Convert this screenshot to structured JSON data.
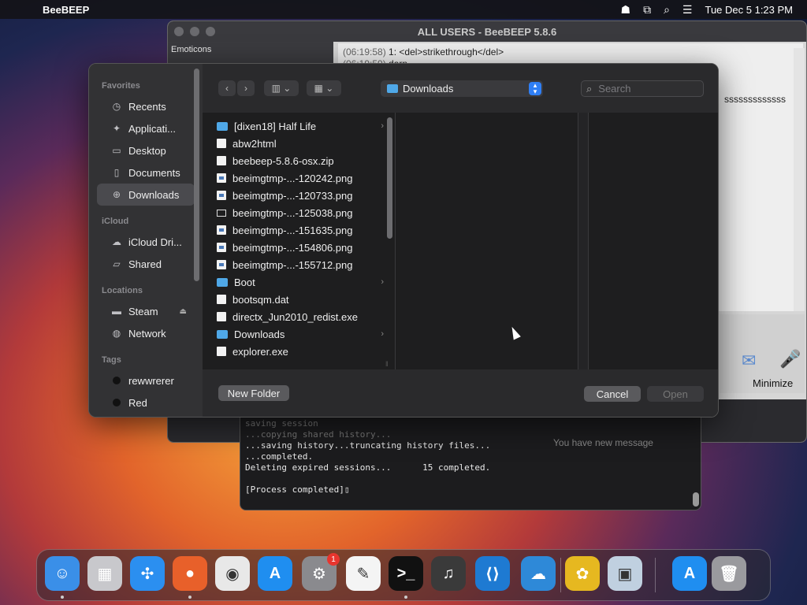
{
  "menubar": {
    "app_name": "BeeBEEP",
    "datetime": "Tue Dec 5  1:23 PM"
  },
  "beebeep": {
    "title": "ALL USERS - BeeBEEP 5.8.6",
    "emoticons_label": "Emoticons",
    "chat_lines": [
      {
        "ts": "(06:19:58)",
        "text": "1: <del>strikethrough</del>"
      },
      {
        "ts": "(06:19:59)",
        "text": "darn"
      }
    ],
    "chat_tail": "sssssssssssss",
    "minimize_label": "Minimize",
    "notification": "You have new message"
  },
  "terminal": {
    "lines": [
      "...saving history...truncating history files...",
      "...completed.",
      "Deleting expired sessions...      15 completed.",
      "",
      "[Process completed]"
    ],
    "faded_lines": [
      "saving session",
      "...copying shared history..."
    ]
  },
  "dialog": {
    "sidebar": {
      "favorites_header": "Favorites",
      "favorites": [
        "Recents",
        "Applicati...",
        "Desktop",
        "Documents",
        "Downloads"
      ],
      "icloud_header": "iCloud",
      "icloud": [
        "iCloud Dri...",
        "Shared"
      ],
      "locations_header": "Locations",
      "locations": [
        "Steam",
        "Network"
      ],
      "tags_header": "Tags",
      "tags": [
        {
          "label": "rewwrerer",
          "color": "#111111"
        },
        {
          "label": "Red",
          "color": "#111111"
        }
      ]
    },
    "location": "Downloads",
    "search_placeholder": "Search",
    "files": [
      {
        "name": "[dixen18] Half Life",
        "kind": "folder",
        "has_children": true
      },
      {
        "name": "abw2html",
        "kind": "doc",
        "has_children": false
      },
      {
        "name": "beebeep-5.8.6-osx.zip",
        "kind": "doc",
        "has_children": false
      },
      {
        "name": "beeimgtmp-...-120242.png",
        "kind": "img",
        "has_children": false
      },
      {
        "name": "beeimgtmp-...-120733.png",
        "kind": "img",
        "has_children": false
      },
      {
        "name": "beeimgtmp-...-125038.png",
        "kind": "blank",
        "has_children": false
      },
      {
        "name": "beeimgtmp-...-151635.png",
        "kind": "img",
        "has_children": false
      },
      {
        "name": "beeimgtmp-...-154806.png",
        "kind": "img",
        "has_children": false
      },
      {
        "name": "beeimgtmp-...-155712.png",
        "kind": "img",
        "has_children": false
      },
      {
        "name": "Boot",
        "kind": "folder",
        "has_children": true
      },
      {
        "name": "bootsqm.dat",
        "kind": "doc",
        "has_children": false
      },
      {
        "name": "directx_Jun2010_redist.exe",
        "kind": "doc",
        "has_children": false
      },
      {
        "name": "Downloads",
        "kind": "folder",
        "has_children": true
      },
      {
        "name": "explorer.exe",
        "kind": "doc",
        "has_children": false
      }
    ],
    "new_folder_label": "New Folder",
    "cancel_label": "Cancel",
    "open_label": "Open"
  },
  "dock": {
    "apps": [
      {
        "name": "finder-icon",
        "color": "#3a8fe8",
        "glyph": "☺"
      },
      {
        "name": "launchpad-icon",
        "color": "#c8c8cc",
        "glyph": "▦"
      },
      {
        "name": "safari-icon",
        "color": "#2b8ff0",
        "glyph": "✣"
      },
      {
        "name": "firefox-icon",
        "color": "#e8602a",
        "glyph": "●"
      },
      {
        "name": "chrome-icon",
        "color": "#e8e8e8",
        "glyph": "◉"
      },
      {
        "name": "app-store-icon",
        "color": "#1f8ef0",
        "glyph": "A"
      },
      {
        "name": "system-settings-icon",
        "color": "#8a8a8e",
        "glyph": "⚙",
        "badge": "1"
      },
      {
        "name": "textedit-icon",
        "color": "#f4f4f4",
        "glyph": "✎"
      },
      {
        "name": "terminal-icon",
        "color": "#111111",
        "glyph": ">_"
      },
      {
        "name": "garageband-icon",
        "color": "#3a3a3a",
        "glyph": "♫"
      },
      {
        "name": "vscode-icon",
        "color": "#1e7ad2",
        "glyph": "⟨⟩"
      },
      {
        "name": "weather-icon",
        "color": "#2e89d8",
        "glyph": "☁"
      },
      {
        "name": "beebeep-icon",
        "color": "#e6b820",
        "glyph": "✿"
      },
      {
        "name": "preview-icon",
        "color": "#c0d0e0",
        "glyph": "▣"
      },
      {
        "name": "app-store-2-icon",
        "color": "#1f8ef0",
        "glyph": "A"
      },
      {
        "name": "trash-icon",
        "color": "#9a9a9e",
        "glyph": "🗑"
      }
    ]
  }
}
